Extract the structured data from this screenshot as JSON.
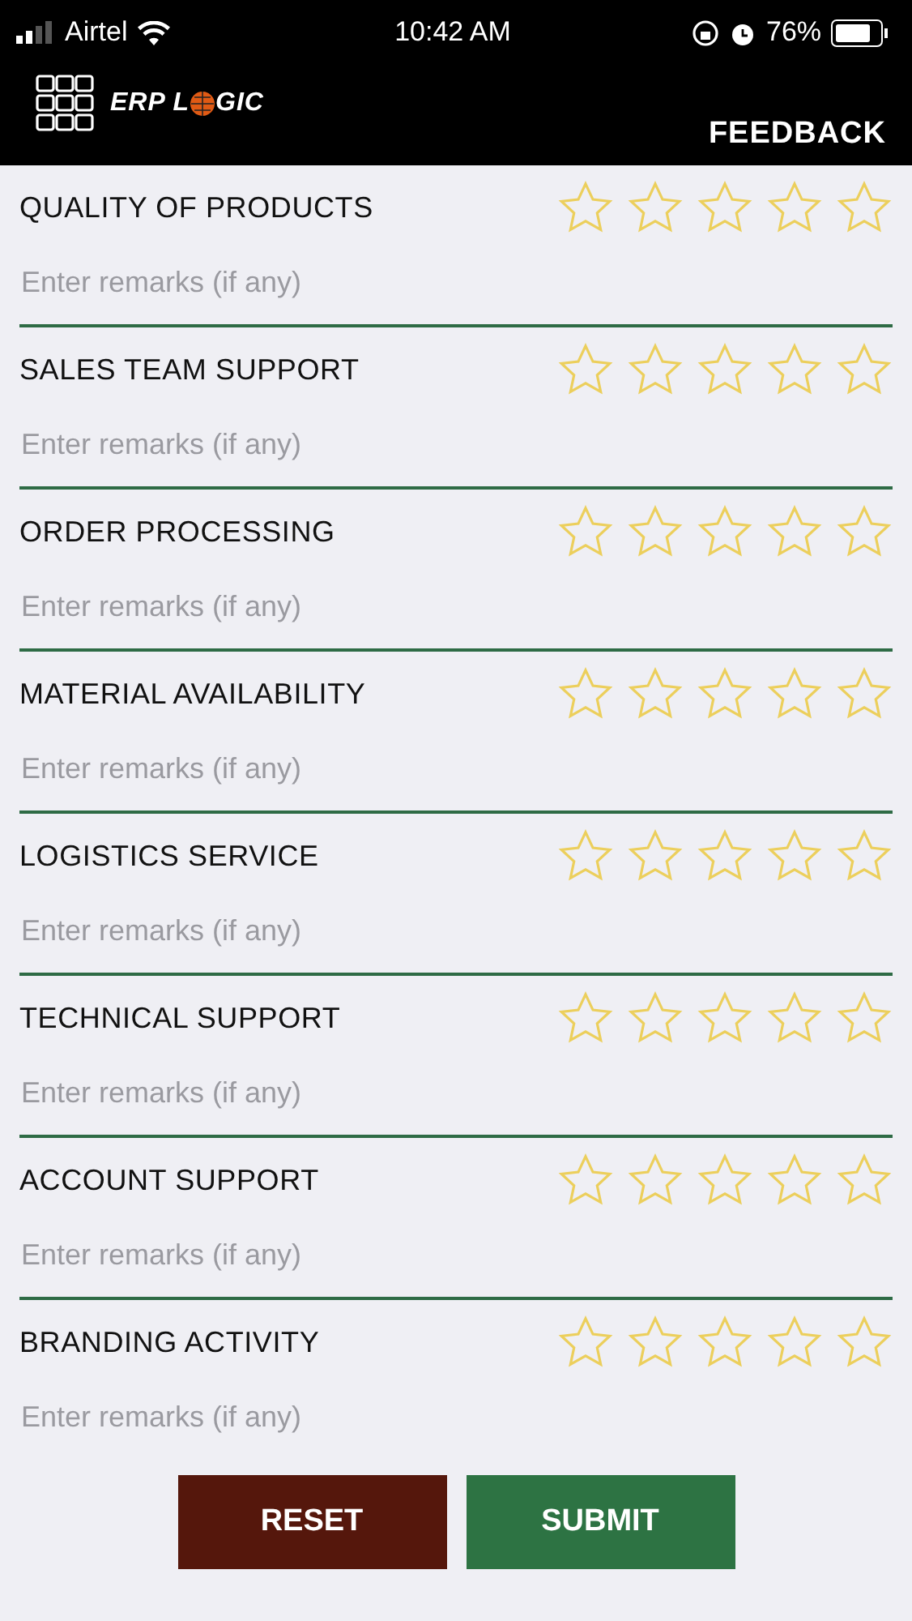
{
  "status_bar": {
    "carrier": "Airtel",
    "time": "10:42 AM",
    "battery": "76%"
  },
  "header": {
    "logo_left": "ERP L",
    "logo_right": "GIC",
    "title": "FEEDBACK"
  },
  "questions": [
    {
      "label": "QUALITY OF PRODUCTS",
      "stars": 0,
      "placeholder": "Enter remarks (if any)"
    },
    {
      "label": "SALES TEAM SUPPORT",
      "stars": 0,
      "placeholder": "Enter remarks (if any)"
    },
    {
      "label": "ORDER PROCESSING",
      "stars": 0,
      "placeholder": "Enter remarks (if any)"
    },
    {
      "label": "MATERIAL AVAILABILITY",
      "stars": 0,
      "placeholder": "Enter remarks (if any)"
    },
    {
      "label": "LOGISTICS SERVICE",
      "stars": 0,
      "placeholder": "Enter remarks (if any)"
    },
    {
      "label": "TECHNICAL SUPPORT",
      "stars": 0,
      "placeholder": "Enter remarks (if any)"
    },
    {
      "label": "ACCOUNT SUPPORT",
      "stars": 0,
      "placeholder": "Enter remarks (if any)"
    },
    {
      "label": "BRANDING ACTIVITY",
      "stars": 0,
      "placeholder": "Enter remarks (if any)"
    }
  ],
  "buttons": [
    {
      "label": "RESET",
      "kind": "reset"
    },
    {
      "label": "SUBMIT",
      "kind": "submit"
    }
  ]
}
